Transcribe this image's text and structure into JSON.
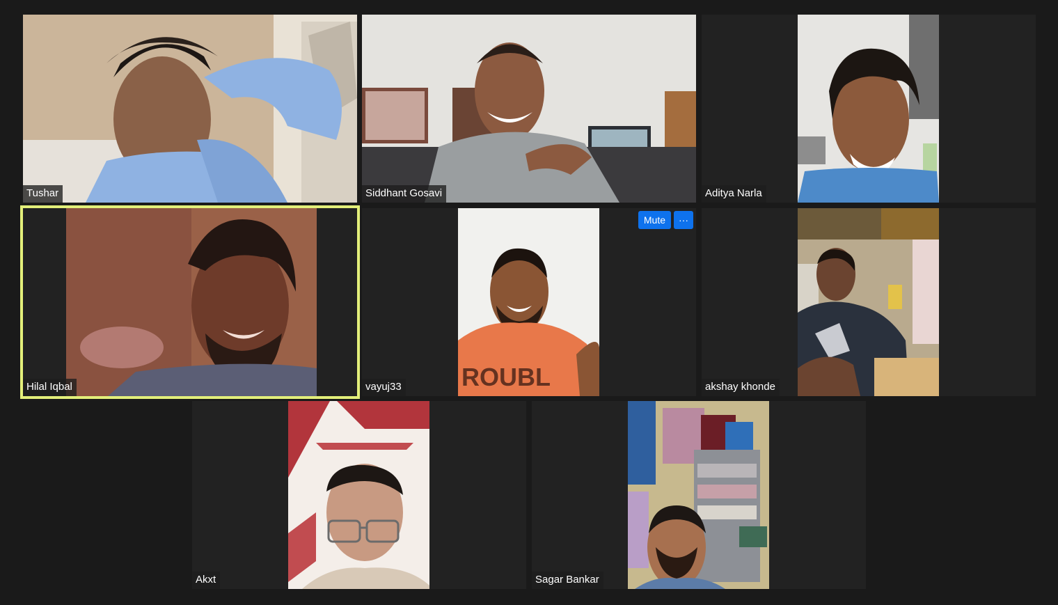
{
  "gallery": {
    "participants": [
      {
        "name": "Tushar"
      },
      {
        "name": "Siddhant Gosavi"
      },
      {
        "name": "Aditya Narla"
      },
      {
        "name": "Hilal Iqbal",
        "active_speaker": true
      },
      {
        "name": "vayuj33"
      },
      {
        "name": "akshay khonde"
      },
      {
        "name": "Akxt"
      },
      {
        "name": "Sagar Bankar"
      }
    ],
    "hover_controls": {
      "mute_label": "Mute",
      "more_label": "···"
    }
  },
  "colors": {
    "background": "#1a1a1a",
    "tile": "#222222",
    "active_speaker_border": "#e3ef7a",
    "accent_button": "#0e72ed"
  }
}
